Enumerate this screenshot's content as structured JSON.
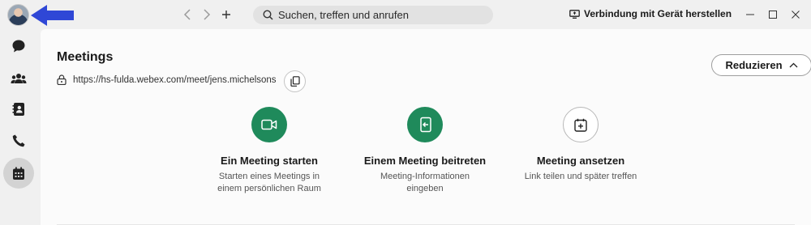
{
  "topbar": {
    "search_placeholder": "Suchen, treffen und anrufen",
    "connect_label": "Verbindung mit Gerät herstellen"
  },
  "meetings": {
    "title": "Meetings",
    "url": "https://hs-fulda.webex.com/meet/jens.michelsons",
    "reduce_label": "Reduzieren",
    "actions": [
      {
        "label": "Ein Meeting starten",
        "desc": "Starten eines Meetings in einem persönlichen Raum"
      },
      {
        "label": "Einem Meeting beitreten",
        "desc": "Meeting-Informationen eingeben"
      },
      {
        "label": "Meeting ansetzen",
        "desc": "Link teilen und später treffen"
      }
    ]
  },
  "colors": {
    "accent_green": "#1f8a5b",
    "annotation_arrow": "#2f47d6"
  }
}
